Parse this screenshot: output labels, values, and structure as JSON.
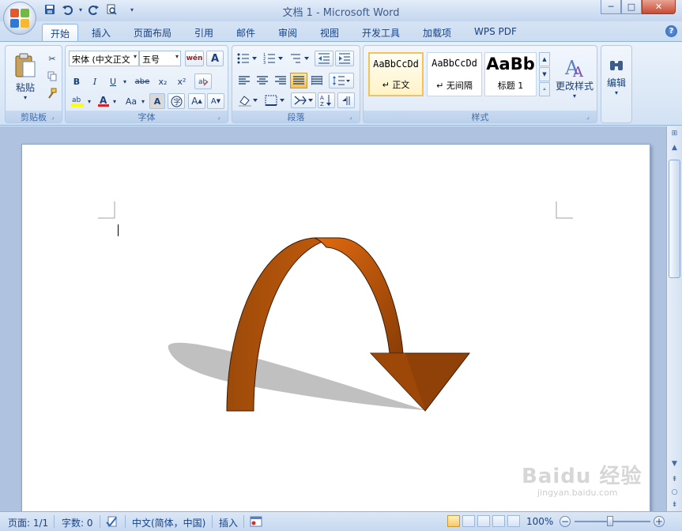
{
  "window": {
    "title": "文档 1 - Microsoft Word",
    "min_label": "─",
    "max_label": "□",
    "close_label": "✕"
  },
  "qat": {
    "save_icon": "save-icon",
    "undo_icon": "undo-icon",
    "redo_icon": "redo-icon",
    "preview_icon": "print-preview-icon"
  },
  "tabs": [
    {
      "label": "开始",
      "active": true
    },
    {
      "label": "插入"
    },
    {
      "label": "页面布局"
    },
    {
      "label": "引用"
    },
    {
      "label": "邮件"
    },
    {
      "label": "审阅"
    },
    {
      "label": "视图"
    },
    {
      "label": "开发工具"
    },
    {
      "label": "加载项"
    },
    {
      "label": "WPS PDF"
    }
  ],
  "help": "?",
  "clipboard": {
    "paste_label": "粘贴",
    "group_label": "剪贴板"
  },
  "font": {
    "font_name": "宋体 (中文正文",
    "font_size": "五号",
    "bold": "B",
    "italic": "I",
    "underline": "U",
    "strike": "abe",
    "subscript": "x₂",
    "superscript": "x²",
    "change_case": "Aa",
    "group_label": "字体"
  },
  "paragraph": {
    "group_label": "段落"
  },
  "styles": {
    "items": [
      {
        "sample": "AaBbCcDd",
        "name": "↵ 正文"
      },
      {
        "sample": "AaBbCcDd",
        "name": "↵ 无间隔"
      },
      {
        "sample": "AaBb",
        "name": "标题 1"
      }
    ],
    "change_label": "更改样式",
    "group_label": "样式"
  },
  "editing": {
    "label": "编辑"
  },
  "status": {
    "page": "页面: 1/1",
    "words": "字数: 0",
    "language": "中文(简体，中国)",
    "mode": "插入",
    "zoom": "100%"
  },
  "watermark": {
    "main": "Baidu 经验",
    "sub": "jingyan.baidu.com"
  },
  "colors": {
    "arrow_light": "#d4660e",
    "arrow_dark": "#8a3d06",
    "shadow": "#c0c0c0"
  }
}
